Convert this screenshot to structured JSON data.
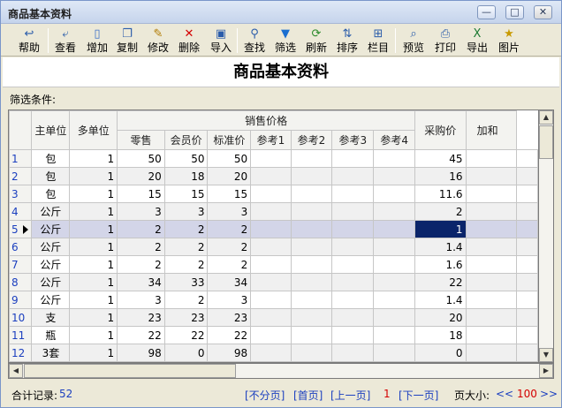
{
  "window": {
    "title": "商品基本资料",
    "min": "—",
    "max": "□",
    "close": "✕"
  },
  "toolbar": [
    {
      "label": "帮助",
      "icon": "↩",
      "name": "help"
    },
    {
      "label": "查看",
      "icon": "⤶",
      "name": "view"
    },
    {
      "label": "增加",
      "icon": "▯",
      "name": "add"
    },
    {
      "label": "复制",
      "icon": "❐",
      "name": "copy"
    },
    {
      "label": "修改",
      "icon": "✎",
      "name": "edit"
    },
    {
      "label": "删除",
      "icon": "✕",
      "name": "delete"
    },
    {
      "label": "导入",
      "icon": "▣",
      "name": "import"
    },
    {
      "label": "查找",
      "icon": "⚲",
      "name": "find"
    },
    {
      "label": "筛选",
      "icon": "▼",
      "name": "filter"
    },
    {
      "label": "刷新",
      "icon": "⟳",
      "name": "refresh"
    },
    {
      "label": "排序",
      "icon": "⇅",
      "name": "sort"
    },
    {
      "label": "栏目",
      "icon": "⊞",
      "name": "columns"
    },
    {
      "label": "预览",
      "icon": "⌕",
      "name": "preview"
    },
    {
      "label": "打印",
      "icon": "⎙",
      "name": "print"
    },
    {
      "label": "导出",
      "icon": "X",
      "name": "export"
    },
    {
      "label": "图片",
      "icon": "★",
      "name": "picture"
    }
  ],
  "page_title": "商品基本资料",
  "filter_label": "筛选条件:",
  "grid": {
    "headers": {
      "main_unit": "主单位",
      "multi_unit": "多单位",
      "sales_group": "销售价格",
      "retail": "零售",
      "member": "会员价",
      "standard": "标准价",
      "ref1": "参考1",
      "ref2": "参考2",
      "ref3": "参考3",
      "ref4": "参考4",
      "purchase": "采购价",
      "markup": "加和"
    },
    "rows": [
      {
        "n": "1",
        "unit": "包",
        "multi": "1",
        "retail": "50",
        "member": "50",
        "standard": "50",
        "purchase": "45"
      },
      {
        "n": "2",
        "unit": "包",
        "multi": "1",
        "retail": "20",
        "member": "18",
        "standard": "20",
        "purchase": "16"
      },
      {
        "n": "3",
        "unit": "包",
        "multi": "1",
        "retail": "15",
        "member": "15",
        "standard": "15",
        "purchase": "11.6"
      },
      {
        "n": "4",
        "unit": "公斤",
        "multi": "1",
        "retail": "3",
        "member": "3",
        "standard": "3",
        "purchase": "2"
      },
      {
        "n": "5",
        "unit": "公斤",
        "multi": "1",
        "retail": "2",
        "member": "2",
        "standard": "2",
        "purchase": "1"
      },
      {
        "n": "6",
        "unit": "公斤",
        "multi": "1",
        "retail": "2",
        "member": "2",
        "standard": "2",
        "purchase": "1.4"
      },
      {
        "n": "7",
        "unit": "公斤",
        "multi": "1",
        "retail": "2",
        "member": "2",
        "standard": "2",
        "purchase": "1.6"
      },
      {
        "n": "8",
        "unit": "公斤",
        "multi": "1",
        "retail": "34",
        "member": "33",
        "standard": "34",
        "purchase": "22"
      },
      {
        "n": "9",
        "unit": "公斤",
        "multi": "1",
        "retail": "3",
        "member": "2",
        "standard": "3",
        "purchase": "1.4"
      },
      {
        "n": "10",
        "unit": "支",
        "multi": "1",
        "retail": "23",
        "member": "23",
        "standard": "23",
        "purchase": "20"
      },
      {
        "n": "11",
        "unit": "瓶",
        "multi": "1",
        "retail": "22",
        "member": "22",
        "standard": "22",
        "purchase": "18"
      },
      {
        "n": "12",
        "unit": "3套",
        "multi": "1",
        "retail": "98",
        "member": "0",
        "standard": "98",
        "purchase": "0"
      }
    ],
    "selected_row": 5
  },
  "status": {
    "total_label": "合计记录:",
    "total_value": "52",
    "no_paging": "[不分页]",
    "first_page": "[首页]",
    "prev_page": "[上一页]",
    "current_page": "1",
    "next_page": "[下一页]",
    "page_size_label": "页大小:",
    "decrease": "<<",
    "page_size": "100",
    "increase": ">>"
  }
}
